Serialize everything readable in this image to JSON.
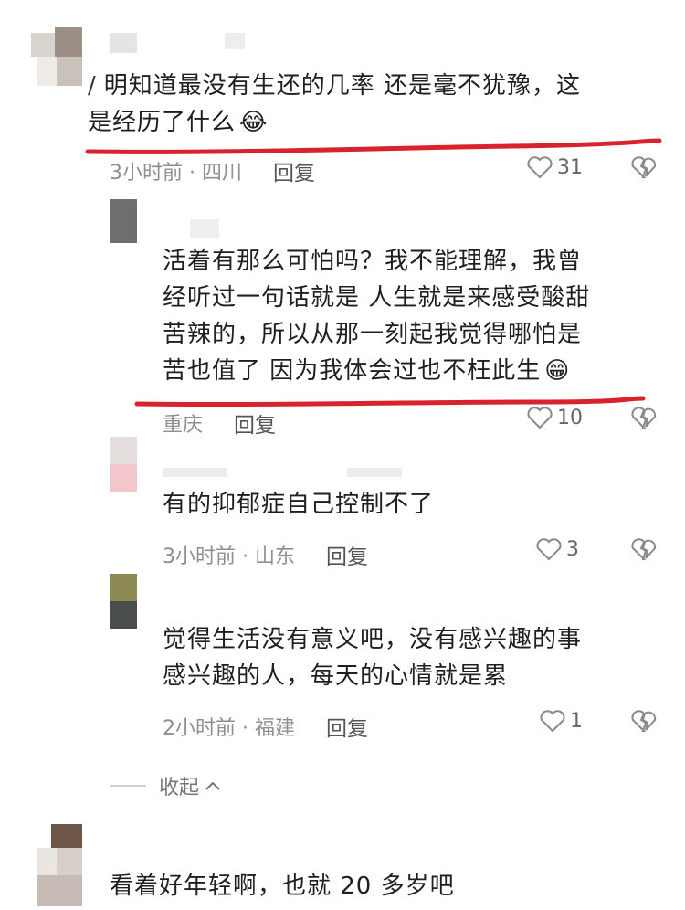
{
  "comments": [
    {
      "text_line1": "明知道最没有生还的几率  还是毫不犹豫，这",
      "text_line2": "是经历了什么",
      "emoji": "😂",
      "meta": "3小时前 · 四川",
      "reply_label": "回复",
      "likes": "31"
    },
    {
      "text_line1": "活着有那么可怕吗？我不能理解，我曾",
      "text_line2": "经听过一句话就是 人生就是来感受酸甜",
      "text_line3": "苦辣的，所以从那一刻起我觉得哪怕是",
      "text_line4": "苦也值了 因为我体会过也不枉此生",
      "emoji": "😁",
      "meta": "重庆",
      "reply_label": "回复",
      "likes": "10"
    },
    {
      "text_line1": "有的抑郁症自己控制不了",
      "meta": "3小时前 · 山东",
      "reply_label": "回复",
      "likes": "3"
    },
    {
      "text_line1": "觉得生活没有意义吧，没有感兴趣的事",
      "text_line2": "感兴趣的人，每天的心情就是累",
      "meta": "2小时前 · 福建",
      "reply_label": "回复",
      "likes": "1"
    },
    {
      "text_line1": "看着好年轻啊，也就 20 多岁吧"
    }
  ],
  "collapse_label": "收起",
  "colors": {
    "underline": "#d8232e",
    "meta": "#8f8f8f"
  }
}
